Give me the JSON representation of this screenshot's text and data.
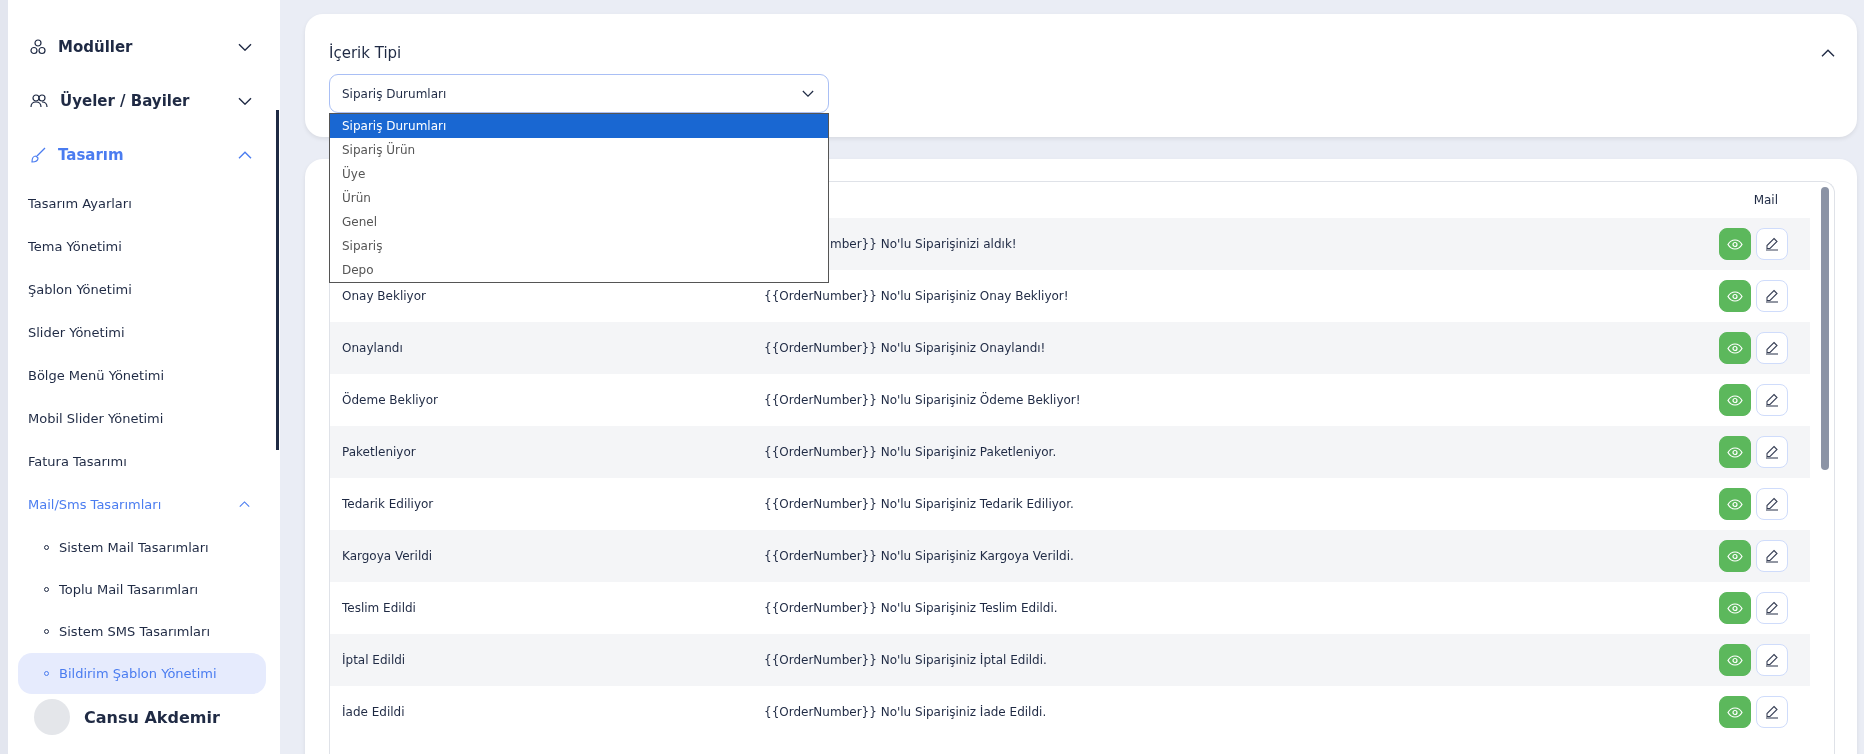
{
  "sidebar": {
    "items": [
      {
        "label": "Modüller",
        "expanded": false,
        "active": false
      },
      {
        "label": "Üyeler / Bayiler",
        "expanded": false,
        "active": false
      },
      {
        "label": "Tasarım",
        "expanded": true,
        "active": true,
        "children": [
          {
            "label": "Tasarım Ayarları"
          },
          {
            "label": "Tema Yönetimi"
          },
          {
            "label": "Şablon Yönetimi"
          },
          {
            "label": "Slider Yönetimi"
          },
          {
            "label": "Bölge Menü Yönetimi"
          },
          {
            "label": "Mobil Slider Yönetimi"
          },
          {
            "label": "Fatura Tasarımı"
          },
          {
            "label": "Mail/Sms Tasarımları",
            "expanded": true,
            "active": true,
            "children": [
              {
                "label": "Sistem Mail Tasarımları",
                "selected": false
              },
              {
                "label": "Toplu Mail Tasarımları",
                "selected": false
              },
              {
                "label": "Sistem SMS Tasarımları",
                "selected": false
              },
              {
                "label": "Bildirim Şablon Yönetimi",
                "selected": true
              }
            ]
          }
        ]
      }
    ],
    "user": {
      "name": "Cansu Akdemir"
    }
  },
  "filter": {
    "title": "İçerik Tipi",
    "expanded": true,
    "select": {
      "value": "Sipariş Durumları",
      "open": true,
      "options": [
        {
          "label": "Sipariş Durumları",
          "selected": true
        },
        {
          "label": "Sipariş Ürün",
          "selected": false
        },
        {
          "label": "Üye",
          "selected": false
        },
        {
          "label": "Ürün",
          "selected": false
        },
        {
          "label": "Genel",
          "selected": false
        },
        {
          "label": "Sipariş",
          "selected": false
        },
        {
          "label": "Depo",
          "selected": false
        }
      ]
    }
  },
  "table": {
    "columns": [
      {
        "label": "Mail"
      }
    ],
    "rows": [
      {
        "template": "mber}} No'lu Siparişinizi aldık!",
        "covered": true
      },
      {
        "name": "Onay Bekliyor",
        "template": "{{OrderNumber}} No'lu Siparişiniz Onay Bekliyor!",
        "covered": false
      },
      {
        "name": "Onaylandı",
        "template": "{{OrderNumber}} No'lu Siparişiniz Onaylandı!",
        "covered": false
      },
      {
        "name": "Ödeme Bekliyor",
        "template": "{{OrderNumber}} No'lu Siparişiniz Ödeme Bekliyor!",
        "covered": false
      },
      {
        "name": "Paketleniyor",
        "template": "{{OrderNumber}} No'lu Siparişiniz Paketleniyor.",
        "covered": false
      },
      {
        "name": "Tedarik Ediliyor",
        "template": "{{OrderNumber}} No'lu Siparişiniz Tedarik Ediliyor.",
        "covered": false
      },
      {
        "name": "Kargoya Verildi",
        "template": "{{OrderNumber}} No'lu Siparişiniz Kargoya Verildi.",
        "covered": false
      },
      {
        "name": "Teslim Edildi",
        "template": "{{OrderNumber}} No'lu Siparişiniz Teslim Edildi.",
        "covered": false
      },
      {
        "name": "İptal Edildi",
        "template": "{{OrderNumber}} No'lu Siparişiniz İptal Edildi.",
        "covered": false
      },
      {
        "name": "İade Edildi",
        "template": "{{OrderNumber}} No'lu Siparişiniz İade Edildi.",
        "covered": false
      }
    ]
  }
}
